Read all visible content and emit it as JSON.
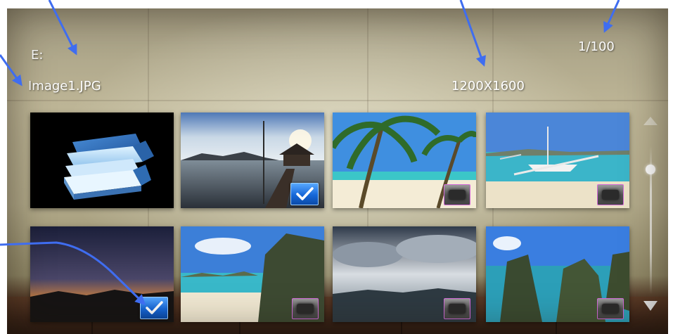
{
  "header": {
    "drive": "E:",
    "filename": "Image1.JPG",
    "resolution": "1200X1600",
    "page_counter": "1/100"
  },
  "thumbnails": [
    {
      "label": "folder",
      "icon": "folder-stack-icon",
      "checkbox": "none"
    },
    {
      "label": "pier-at-sunset",
      "checkbox": "checked"
    },
    {
      "label": "palm-tree-beach",
      "checkbox": "unchecked"
    },
    {
      "label": "outrigger-boat",
      "checkbox": "unchecked"
    },
    {
      "label": "dusk-horizon",
      "checkbox": "checked"
    },
    {
      "label": "tropical-cove",
      "checkbox": "unchecked"
    },
    {
      "label": "cloudy-sky-sea",
      "checkbox": "unchecked"
    },
    {
      "label": "limestone-lagoon",
      "checkbox": "unchecked"
    }
  ],
  "scrollbar": {
    "position": 0.1
  },
  "colors": {
    "text": "#ffffff",
    "check_blue": "#1667d8",
    "uncheck_border": "#d36ad9",
    "annotation_arrow": "#3f6df0"
  },
  "icons": {
    "scroll_up": "triangle-up-icon",
    "scroll_down": "triangle-down-icon",
    "checked": "checkmark-icon"
  }
}
